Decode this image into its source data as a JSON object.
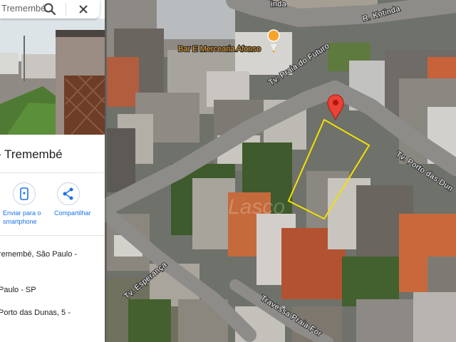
{
  "search": {
    "value": "Tremembé",
    "search_icon": "search-icon",
    "close_icon": "close-icon"
  },
  "place": {
    "title": "- Tremembé",
    "actions": [
      {
        "icon": "smartphone-icon",
        "label_line1": "Enviar para o",
        "label_line2": "smartphone"
      },
      {
        "icon": "share-icon",
        "label_line1": "Compartilhar",
        "label_line2": ""
      }
    ],
    "address_lines": [
      "remembé, São Paulo -",
      "Paulo - SP",
      "Porto das Dunas, 5 -"
    ]
  },
  "map": {
    "streets": {
      "r_kotinda": "R. Kotinda",
      "tv_praia_do_futuro": "Tv. Praia do Futuro",
      "tv_porto_das_dunas": "Tv. Porto das Dun",
      "tv_esperanca": "Tv. Esperança",
      "travessa_praia_fortaleza": "Travessa Praia For",
      "kotinda_top": "inda"
    },
    "poi": {
      "label": "Bar E Mercearia Afonso",
      "icon": "food-drink-pin-icon",
      "color": "#f6a42c"
    },
    "marker": {
      "icon": "red-location-pin-icon",
      "color": "#ea4335"
    },
    "lot_outline_color": "#f2e200",
    "watermark": "Lasco"
  }
}
